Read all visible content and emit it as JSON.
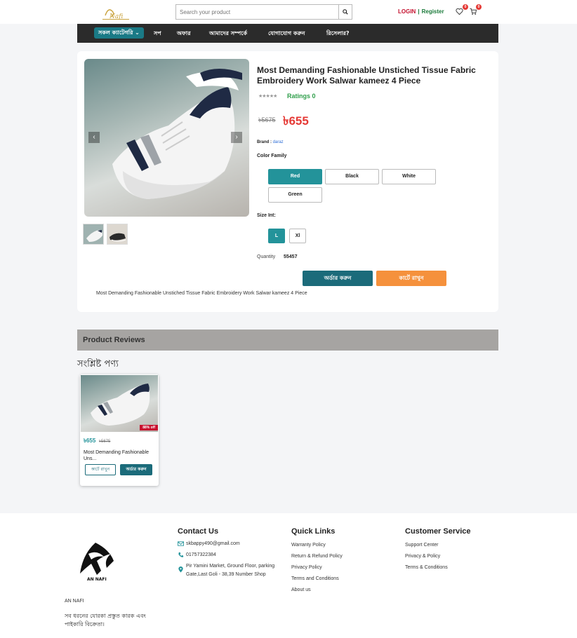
{
  "header": {
    "search_placeholder": "Search your product",
    "login": "LOGIN",
    "separator": "|",
    "register": "Register",
    "wishlist_count": "0",
    "cart_count": "0"
  },
  "nav": {
    "category_button": "সকল ক্যাটেগরি",
    "items": [
      "সপ",
      "অফার",
      "আমাদের সম্পর্কে",
      "যোগাযোগ করুন",
      "রিসেলার?"
    ]
  },
  "product": {
    "title": "Most Demanding Fashionable Unstiched Tissue Fabric Embroidery Work Salwar kameez 4 Piece",
    "stars": "★★★★★",
    "ratings": "Ratings 0",
    "old_price": "৳5675",
    "new_price": "৳655",
    "brand_label": "Brand :",
    "brand_value": "daraz",
    "color_label": "Color Family",
    "colors": [
      "Red",
      "Black",
      "White",
      "Green"
    ],
    "selected_color": "Red",
    "size_label": "Size Int:",
    "sizes": [
      "L",
      "Xl"
    ],
    "selected_size": "L",
    "quantity_label": "Quantity",
    "quantity_value": "55457",
    "order_button": "অর্ডার করুন",
    "cart_button": "কার্টে রাখুন",
    "description": "Most Demanding Fashionable Unstiched Tissue Fabric Embroidery Work Salwar kameez 4 Piece"
  },
  "reviews": {
    "title": "Product Reviews"
  },
  "related": {
    "title": "সংশ্লিষ্ট পণ্য",
    "card": {
      "discount": "88% off",
      "price": "৳655",
      "old_price": "৳5675",
      "name": "Most Demanding Fashionable Uns...",
      "cart_button": "কার্টে রাখুন",
      "order_button": "অর্ডার করুন"
    }
  },
  "footer": {
    "brand": "AN NAFI",
    "tagline": "সব ধরনের যোরকা প্রস্তুত কারক এবং পাইকারি বিক্রেতা।",
    "contact": {
      "title": "Contact Us",
      "email": "skbappy490@gmail.com",
      "phone": "01757322384",
      "address": "Pir Yamini Market, Ground Floor, parking Gate,Last Goli - 38,39 Number Shop"
    },
    "quick_links": {
      "title": "Quick Links",
      "items": [
        "Warranty Policy",
        "Return & Refund Policy",
        "Privacy Policy",
        "Terms and Conditions",
        "About us"
      ]
    },
    "customer_service": {
      "title": "Customer Service",
      "items": [
        "Support Center",
        "Privacy & Policy",
        "Terms & Conditions"
      ]
    }
  },
  "colors": {
    "accent": "#23939a",
    "order": "#1b6b7a",
    "cart": "#f5913c",
    "price": "#e53935",
    "nav_bg": "#2b2b2b"
  }
}
